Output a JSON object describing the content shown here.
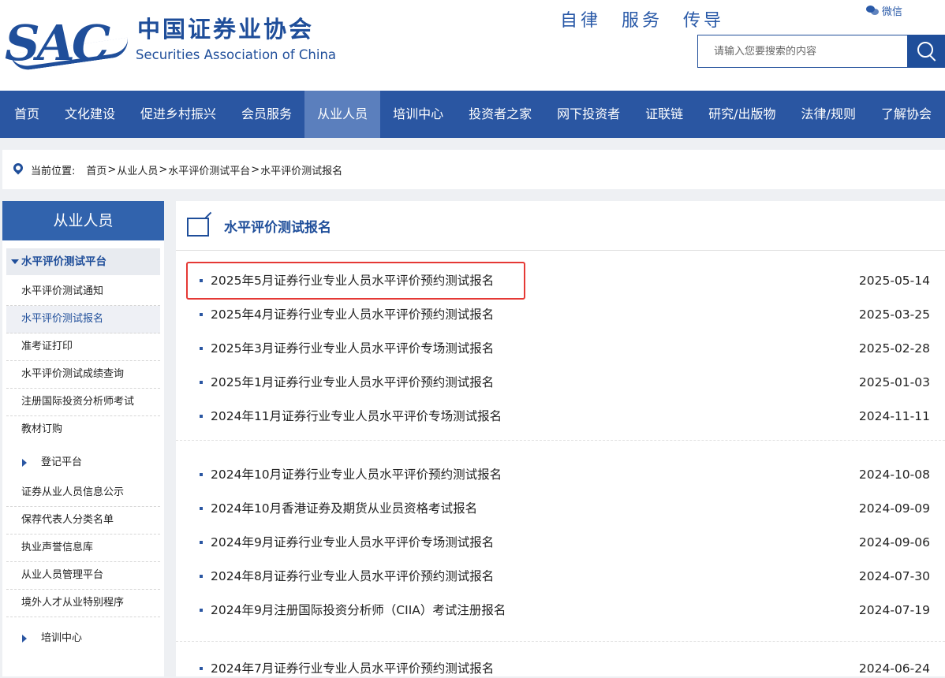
{
  "header": {
    "logo_text": "SAC",
    "org_name_cn": "中国证券业协会",
    "org_name_en": "Securities Association of China",
    "slogan": "自律　服务　传导",
    "wechat_label": "微信",
    "search_placeholder": "请输入您要搜索的内容"
  },
  "nav": [
    {
      "label": "首页"
    },
    {
      "label": "文化建设"
    },
    {
      "label": "促进乡村振兴"
    },
    {
      "label": "会员服务"
    },
    {
      "label": "从业人员",
      "active": true
    },
    {
      "label": "培训中心"
    },
    {
      "label": "投资者之家"
    },
    {
      "label": "网下投资者"
    },
    {
      "label": "证联链"
    },
    {
      "label": "研究/出版物"
    },
    {
      "label": "法律/规则"
    },
    {
      "label": "了解协会"
    }
  ],
  "breadcrumb": {
    "label": "当前位置:",
    "items": [
      "首页",
      "从业人员",
      "水平评价测试平台",
      "水平评价测试报名"
    ],
    "separator": ">"
  },
  "sidebar": {
    "title": "从业人员",
    "active_section": "水平评价测试平台",
    "section_items": [
      "水平评价测试通知",
      "水平评价测试报名",
      "准考证打印",
      "水平评价测试成绩查询",
      "注册国际投资分析师考试",
      "教材订购"
    ],
    "group1": "登记平台",
    "group1_items": [
      "证券从业人员信息公示",
      "保荐代表人分类名单",
      "执业声誉信息库",
      "从业人员管理平台",
      "境外人才从业特别程序"
    ],
    "group2": "培训中心"
  },
  "main": {
    "title": "水平评价测试报名",
    "rows": [
      {
        "title": "2025年5月证券行业专业人员水平评价预约测试报名",
        "date": "2025-05-14"
      },
      {
        "title": "2025年4月证券行业专业人员水平评价预约测试报名",
        "date": "2025-03-25"
      },
      {
        "title": "2025年3月证券行业专业人员水平评价专场测试报名",
        "date": "2025-02-28"
      },
      {
        "title": "2025年1月证券行业专业人员水平评价预约测试报名",
        "date": "2025-01-03"
      },
      {
        "title": "2024年11月证券行业专业人员水平评价专场测试报名",
        "date": "2024-11-11"
      },
      {
        "title": "2024年10月证券行业专业人员水平评价预约测试报名",
        "date": "2024-10-08"
      },
      {
        "title": "2024年10月香港证券及期货从业员资格考试报名",
        "date": "2024-09-09"
      },
      {
        "title": "2024年9月证券行业专业人员水平评价专场测试报名",
        "date": "2024-09-06"
      },
      {
        "title": "2024年8月证券行业专业人员水平评价预约测试报名",
        "date": "2024-07-30"
      },
      {
        "title": "2024年9月注册国际投资分析师（CIIA）考试注册报名",
        "date": "2024-07-19"
      },
      {
        "title": "2024年7月证券行业专业人员水平评价预约测试报名",
        "date": "2024-06-24"
      }
    ]
  }
}
